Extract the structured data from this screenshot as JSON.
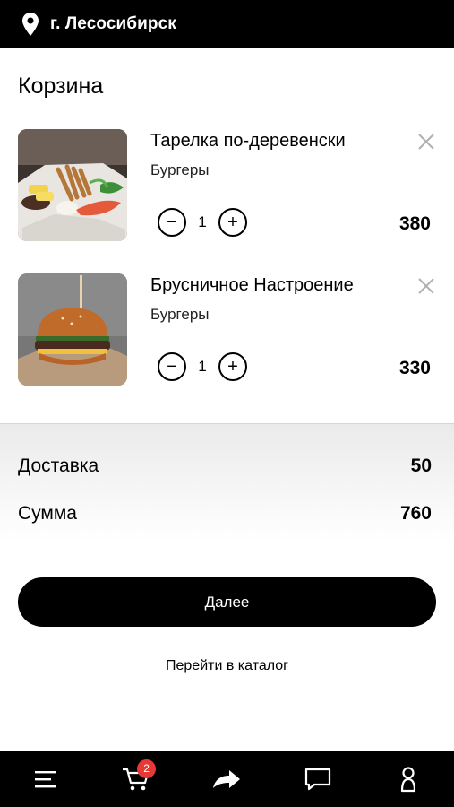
{
  "header": {
    "city": "г. Лесосибирск",
    "icon": "location-pin-icon"
  },
  "page": {
    "title": "Корзина"
  },
  "cart": {
    "items": [
      {
        "name": "Тарелка по-деревенски",
        "category": "Бургеры",
        "quantity": "1",
        "price": "380",
        "minus": "−",
        "plus": "+"
      },
      {
        "name": "Брусничное Настроение",
        "category": "Бургеры",
        "quantity": "1",
        "price": "330",
        "minus": "−",
        "plus": "+"
      }
    ]
  },
  "summary": {
    "delivery_label": "Доставка",
    "delivery_value": "50",
    "total_label": "Сумма",
    "total_value": "760"
  },
  "actions": {
    "next_label": "Далее",
    "catalog_label": "Перейти в каталог"
  },
  "bottom_nav": {
    "items": [
      {
        "icon": "menu-icon"
      },
      {
        "icon": "cart-icon",
        "badge": "2"
      },
      {
        "icon": "share-arrow-icon"
      },
      {
        "icon": "chat-icon"
      },
      {
        "icon": "profile-icon"
      }
    ]
  },
  "colors": {
    "bar_bg": "#000000",
    "badge": "#e53935",
    "accent": "#000000"
  }
}
